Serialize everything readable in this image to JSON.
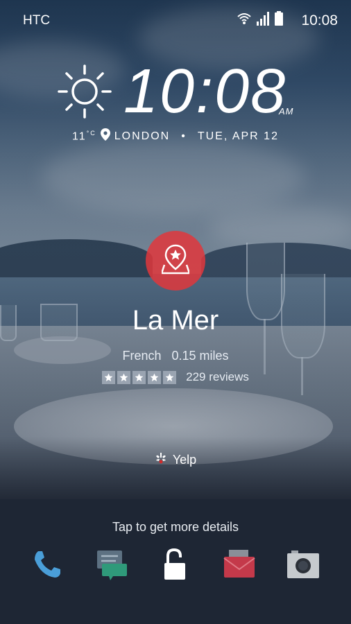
{
  "status_bar": {
    "carrier": "HTC",
    "time": "10:08",
    "icons": [
      "wifi-icon",
      "signal-icon",
      "battery-icon"
    ]
  },
  "clock": {
    "time": "10:08",
    "ampm": "AM",
    "weather_icon": "sun-icon",
    "temperature": "11",
    "temperature_unit": "°C",
    "location": "LONDON",
    "separator": "•",
    "date": "TUE, APR 12"
  },
  "place_card": {
    "icon": "map-pin-star-icon",
    "accent_color": "#e1373c",
    "name": "La Mer",
    "cuisine": "French",
    "distance": "0.15 miles",
    "rating": 5,
    "reviews": "229 reviews",
    "source_icon": "yelp-icon",
    "source": "Yelp"
  },
  "lockscreen": {
    "hint": "Tap to get more details",
    "dock": [
      {
        "name": "phone",
        "icon": "phone-icon"
      },
      {
        "name": "messages",
        "icon": "message-icon"
      },
      {
        "name": "unlock",
        "icon": "unlock-icon"
      },
      {
        "name": "mail",
        "icon": "mail-icon"
      },
      {
        "name": "camera",
        "icon": "camera-icon"
      }
    ]
  }
}
